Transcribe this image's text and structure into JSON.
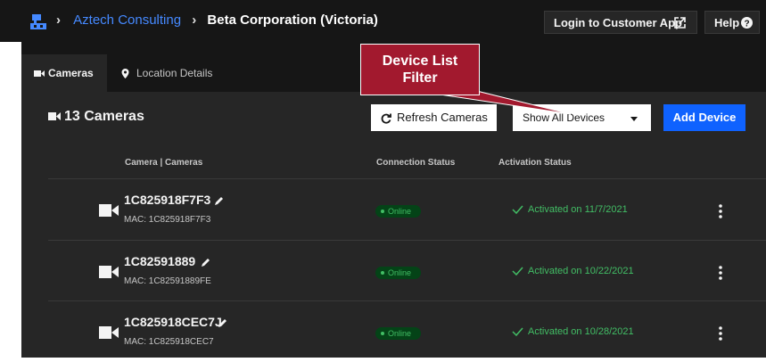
{
  "breadcrumb": {
    "org": "Aztech Consulting",
    "site": "Beta Corporation (Victoria)"
  },
  "header": {
    "login_label": "Login to Customer App",
    "help_label": "Help"
  },
  "tabs": [
    {
      "label": "Cameras"
    },
    {
      "label": "Location Details"
    }
  ],
  "callout": {
    "line1": "Device List",
    "line2": "Filter"
  },
  "main": {
    "title": "13 Cameras",
    "refresh_label": "Refresh Cameras",
    "filter_value": "Show All Devices",
    "add_label": "Add Device"
  },
  "columns": {
    "camera": "Camera | Cameras",
    "connection": "Connection Status",
    "activation": "Activation Status"
  },
  "cameras": [
    {
      "name": "1C825918F7F3",
      "mac": "MAC: 1C825918F7F3",
      "status": "Online",
      "activation": "Activated on 11/7/2021"
    },
    {
      "name": "1C82591889",
      "mac": "MAC: 1C82591889FE",
      "status": "Online",
      "activation": "Activated on 10/22/2021"
    },
    {
      "name": "1C825918CEC7J",
      "mac": "MAC: 1C825918CEC7",
      "status": "Online",
      "activation": "Activated on 10/28/2021"
    }
  ],
  "colors": {
    "accent": "#0f62fe",
    "link": "#4589ff",
    "success": "#42be65",
    "callout": "#a2192e"
  }
}
